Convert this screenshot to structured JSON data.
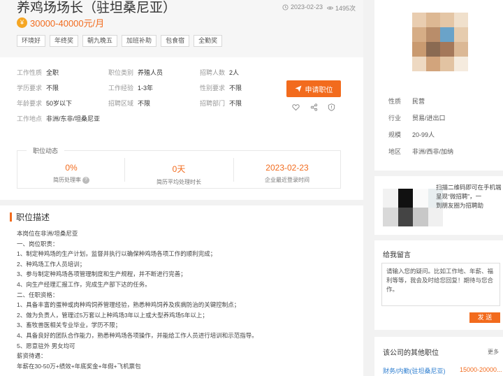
{
  "job": {
    "title": "养鸡场场长（驻坦桑尼亚）",
    "date": "2023-02-23",
    "views": "1495次",
    "salary": "30000-40000元/月",
    "tags": [
      "环境好",
      "年终奖",
      "朝九晚五",
      "加班补助",
      "包食宿",
      "全勤奖"
    ]
  },
  "attributes": {
    "work_type": {
      "label": "工作性质",
      "value": "全职"
    },
    "category": {
      "label": "职位类别",
      "value": "养殖人员"
    },
    "headcount": {
      "label": "招聘人数",
      "value": "2人"
    },
    "education": {
      "label": "学历要求",
      "value": "不限"
    },
    "experience": {
      "label": "工作经验",
      "value": "1-3年"
    },
    "gender": {
      "label": "性别要求",
      "value": "不限"
    },
    "age": {
      "label": "年龄要求",
      "value": "50岁以下"
    },
    "region": {
      "label": "招聘区域",
      "value": "不限"
    },
    "department": {
      "label": "招聘部门",
      "value": "不限"
    },
    "location": {
      "label": "工作地点",
      "value": "非洲/东非/坦桑尼亚"
    }
  },
  "apply_label": "申请职位",
  "dynamics": {
    "title": "职位动态",
    "stats": [
      {
        "value": "0%",
        "label": "简历处理率"
      },
      {
        "value": "0天",
        "label": "简历平均处理时长"
      },
      {
        "value": "2023-02-23",
        "label": "企业最近登录时间"
      }
    ]
  },
  "description": {
    "title": "职位描述",
    "lines": [
      "本岗位在非洲/坦桑尼亚",
      "一、岗位职责：",
      "1、制定种鸡场的生产计划，监督并执行以确保种鸡场各项工作的顺利完成；",
      "2、种鸡场工作人员培训；",
      "3、参与制定种鸡场各项管理制度和生产规程，并不断进行完善；",
      "4、向生产经理汇报工作，完成生产部下达的任务。",
      "二、任职资格：",
      "1、具备丰富的蛋种或肉种鸡饲养管理经验，熟悉种鸡饲养及疾病防治的关键控制点；",
      "2、做为负责人，管理过5万套以上种鸡场3年以上或大型养鸡场5年以上；",
      "3、畜牧兽医相关专业毕业，学历不限；",
      "4、具备良好的团队合作能力，熟悉种鸡场各项操作，并能给工作人员进行培训和示范指导。",
      "5、愿意驻外 男女均可",
      "薪资待遇：",
      "年薪在30-50万+绩效+年底奖金+年假+飞机票包"
    ]
  },
  "company": {
    "info": [
      {
        "label": "性质",
        "value": "民营"
      },
      {
        "label": "行业",
        "value": "贸易/进出口"
      },
      {
        "label": "规模",
        "value": "20-99人"
      },
      {
        "label": "地区",
        "value": "非洲/西非/加纳"
      }
    ]
  },
  "qr_lines": [
    "扫描二维码即可在手机端",
    "呈现“微招聘”，一",
    "到朋友圈为招聘助"
  ],
  "message": {
    "title": "给我留言",
    "placeholder": "请输入您的疑问。比如工作地、年薪、福利等等，我会及时给您回复！期待与您合作。",
    "send_label": "发 送"
  },
  "other_jobs": {
    "title": "该公司的其他职位",
    "more": "更多",
    "items": [
      {
        "title": "财务/内勤(驻坦桑尼亚)",
        "salary": "15000-20000..."
      }
    ]
  },
  "colors": {
    "accent": "#f26b1d",
    "link": "#2f7fd0",
    "tag_yen": "#f5a623"
  }
}
